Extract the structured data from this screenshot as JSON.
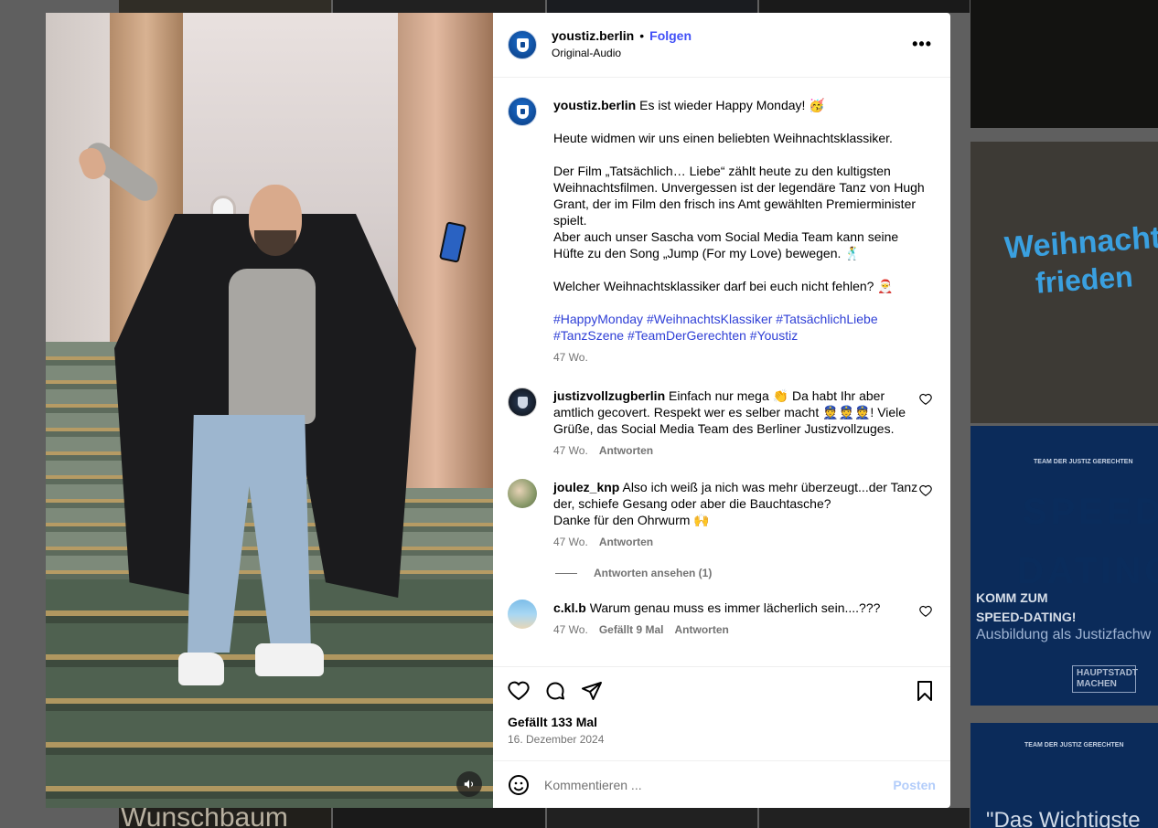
{
  "background": {
    "tile_texts": {
      "weihnachts": "Weihnachts",
      "frieden": "frieden",
      "speed": "SPEED",
      "dating": "DATING",
      "komm": "KOMM ZUM SPEED-DATING!",
      "ausbildung": "Ausbildung als Justizfachw",
      "hauptstadt": "HAUPTSTADT MACHEN",
      "team1": "TEAM DER  JUSTIZ  GERECHTEN",
      "team2": "TEAM DER  JUSTIZ  GERECHTEN",
      "wichtigste": "\"Das Wichtigste",
      "wunschbaum": "Wunschbaum"
    }
  },
  "post": {
    "username": "youstiz.berlin",
    "separator": "•",
    "follow_label": "Folgen",
    "audio_label": "Original-Audio",
    "more_icon": "more-horizontal-icon",
    "sound_icon": "speaker-icon"
  },
  "caption": {
    "username": "youstiz.berlin",
    "line1": "Es ist wieder Happy Monday! 🥳",
    "line2": "Heute widmen wir uns einen beliebten Weihnachtsklassiker.",
    "line3": "Der Film „Tatsächlich… Liebe“ zählt heute zu den kultigsten Weihnachtsfilmen. Unvergessen ist der legendäre Tanz von Hugh Grant, der im Film den frisch ins Amt gewählten Premierminister spielt.",
    "line4": "Aber auch unser Sascha vom Social Media Team kann seine Hüfte zu den Song „Jump (For my Love) bewegen. 🕺",
    "line5": "Welcher Weihnachtsklassiker darf bei euch nicht fehlen? 🎅",
    "hashtags": "#HappyMonday #WeihnachtsKlassiker #TatsächlichLiebe #TanzSzene #TeamDerGerechten #Youstiz",
    "time": "47 Wo."
  },
  "comments": [
    {
      "username": "justizvollzugberlin",
      "text": "Einfach nur mega 👏 Da habt Ihr aber amtlich gecovert. Respekt wer es selber macht 👮👮👮! Viele Grüße, das Social Media Team des Berliner Justizvollzuges.",
      "time": "47 Wo.",
      "reply": "Antworten",
      "likes": ""
    },
    {
      "username": "joulez_knp",
      "text": "Also ich weiß ja nich was mehr überzeugt...der Tanz der, schiefe Gesang oder aber die Bauchtasche?",
      "text2": "Danke für den Ohrwurm 🙌",
      "time": "47 Wo.",
      "reply": "Antworten",
      "view_replies": "Antworten ansehen (1)"
    },
    {
      "username": "c.kl.b",
      "text": "Warum genau muss es immer lächerlich sein....???",
      "time": "47 Wo.",
      "likes": "Gefällt 9 Mal",
      "reply": "Antworten"
    }
  ],
  "actions": {
    "like_icon": "heart-icon",
    "comment_icon": "comment-icon",
    "share_icon": "paper-plane-icon",
    "save_icon": "bookmark-icon",
    "likes_text": "Gefällt 133 Mal",
    "date": "16. Dezember 2024"
  },
  "compose": {
    "placeholder": "Kommentieren ...",
    "post_label": "Posten",
    "emoji_icon": "smiley-icon"
  }
}
